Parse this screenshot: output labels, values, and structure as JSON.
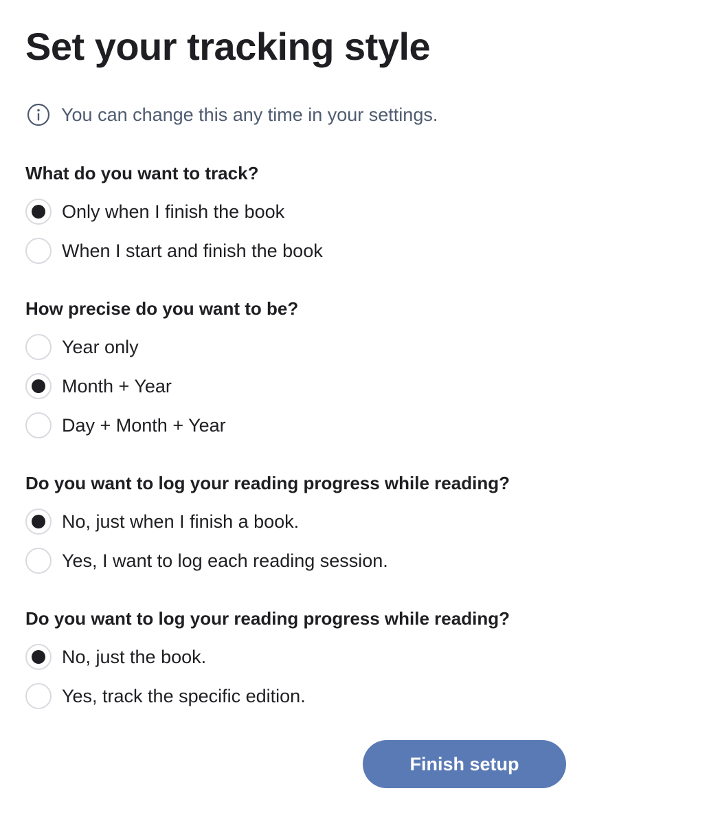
{
  "title": "Set your tracking style",
  "info": {
    "icon": "info-circle-icon",
    "text": "You can change this any time in your settings."
  },
  "sections": [
    {
      "question": "What do you want to track?",
      "options": [
        {
          "label": "Only when I finish the book",
          "selected": true
        },
        {
          "label": "When I start and finish the book",
          "selected": false
        }
      ]
    },
    {
      "question": "How precise do you want to be?",
      "options": [
        {
          "label": "Year only",
          "selected": false
        },
        {
          "label": "Month + Year",
          "selected": true
        },
        {
          "label": "Day + Month + Year",
          "selected": false
        }
      ]
    },
    {
      "question": "Do you want to log your reading progress while reading?",
      "options": [
        {
          "label": "No, just when I finish a book.",
          "selected": true
        },
        {
          "label": "Yes, I want to log each reading session.",
          "selected": false
        }
      ]
    },
    {
      "question": "Do you want to log your reading progress while reading?",
      "options": [
        {
          "label": "No, just the book.",
          "selected": true
        },
        {
          "label": "Yes, track the specific edition.",
          "selected": false
        }
      ]
    }
  ],
  "finish_button": {
    "label": "Finish setup"
  },
  "colors": {
    "button": "#5a7ab5",
    "info_text": "#4f5b70",
    "radio_border": "#d8dadf",
    "text": "#1f1f23"
  }
}
